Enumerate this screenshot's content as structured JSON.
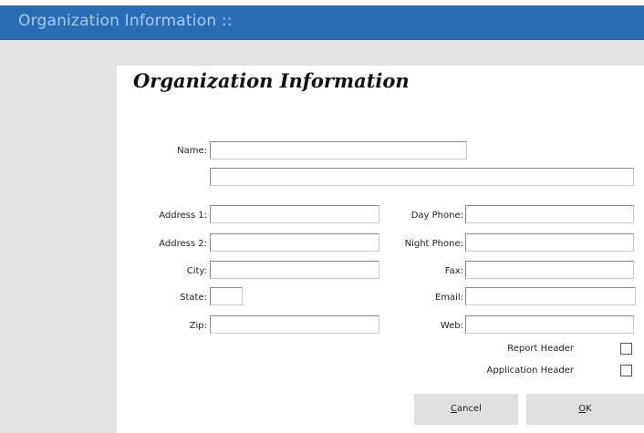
{
  "window": {
    "title": "Organization Information ::"
  },
  "form": {
    "heading": "Organization Information",
    "name_label": "Name:",
    "name_value": "",
    "name_line2_value": "",
    "address1_label": "Address 1:",
    "address1_value": "",
    "address2_label": "Address 2:",
    "address2_value": "",
    "city_label": "City:",
    "city_value": "",
    "state_label": "State:",
    "state_value": "",
    "zip_label": "Zip:",
    "zip_value": "",
    "day_phone_label": "Day Phone:",
    "day_phone_value": "",
    "night_phone_label": "Night Phone:",
    "night_phone_value": "",
    "fax_label": "Fax:",
    "fax_value": "",
    "email_label": "Email:",
    "email_value": "",
    "web_label": "Web:",
    "web_value": "",
    "report_header_label": "Report Header",
    "report_header_checked": false,
    "application_header_label": "Application Header",
    "application_header_checked": false
  },
  "buttons": {
    "cancel_hotkey": "C",
    "cancel_rest": "ancel",
    "ok_hotkey": "O",
    "ok_rest": "K"
  },
  "colors": {
    "titlebar": "#2a6db4",
    "titlebar_text": "#a9c9ec",
    "panel": "#e3e3e3"
  }
}
